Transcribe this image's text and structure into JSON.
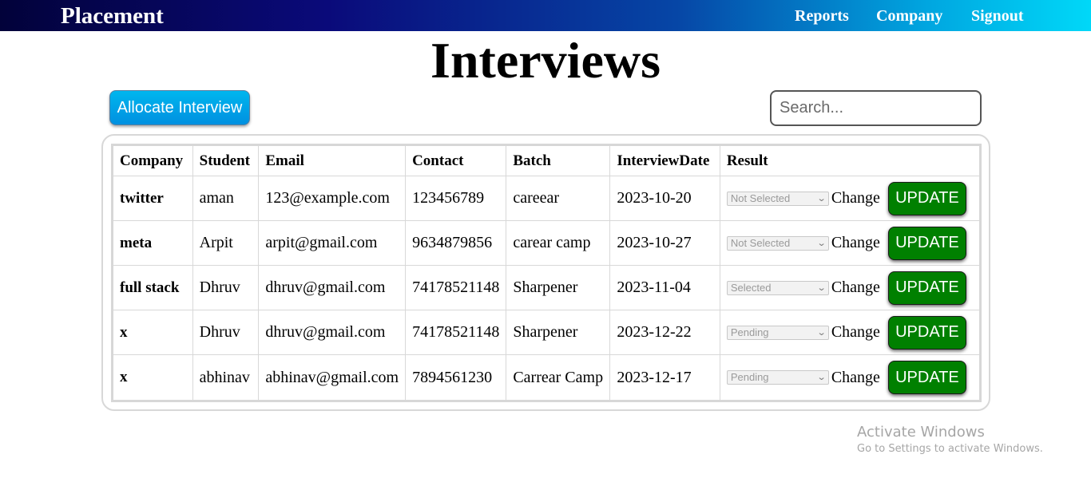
{
  "navbar": {
    "brand": "Placement",
    "links": [
      "Reports",
      "Company",
      "Signout"
    ]
  },
  "page": {
    "title": "Interviews"
  },
  "toolbar": {
    "allocate_label": "Allocate Interview",
    "search_placeholder": "Search...",
    "search_value": ""
  },
  "table": {
    "columns": [
      "Company",
      "Student",
      "Email",
      "Contact",
      "Batch",
      "InterviewDate",
      "Result"
    ],
    "change_label": "Change",
    "update_label": "UPDATE",
    "rows": [
      {
        "company": "twitter",
        "student": "aman",
        "email": "123@example.com",
        "contact": "123456789",
        "batch": "careear",
        "date": "2023-10-20",
        "result": "Not Selected"
      },
      {
        "company": "meta",
        "student": "Arpit",
        "email": "arpit@gmail.com",
        "contact": "9634879856",
        "batch": "carear camp",
        "date": "2023-10-27",
        "result": "Not Selected"
      },
      {
        "company": "full stack",
        "student": "Dhruv",
        "email": "dhruv@gmail.com",
        "contact": "74178521148",
        "batch": "Sharpener",
        "date": "2023-11-04",
        "result": "Selected"
      },
      {
        "company": "x",
        "student": "Dhruv",
        "email": "dhruv@gmail.com",
        "contact": "74178521148",
        "batch": "Sharpener",
        "date": "2023-12-22",
        "result": "Pending"
      },
      {
        "company": "x",
        "student": "abhinav",
        "email": "abhinav@gmail.com",
        "contact": "7894561230",
        "batch": "Carrear Camp",
        "date": "2023-12-17",
        "result": "Pending"
      }
    ]
  },
  "watermark": {
    "line1": "Activate Windows",
    "line2": "Go to Settings to activate Windows."
  },
  "colors": {
    "update_button": "#008000",
    "allocate_button": "#00b6ee",
    "navbar_start": "#02023a",
    "navbar_end": "#00d8f8"
  },
  "icons": {
    "select_arrow": "chevron-down-icon"
  }
}
